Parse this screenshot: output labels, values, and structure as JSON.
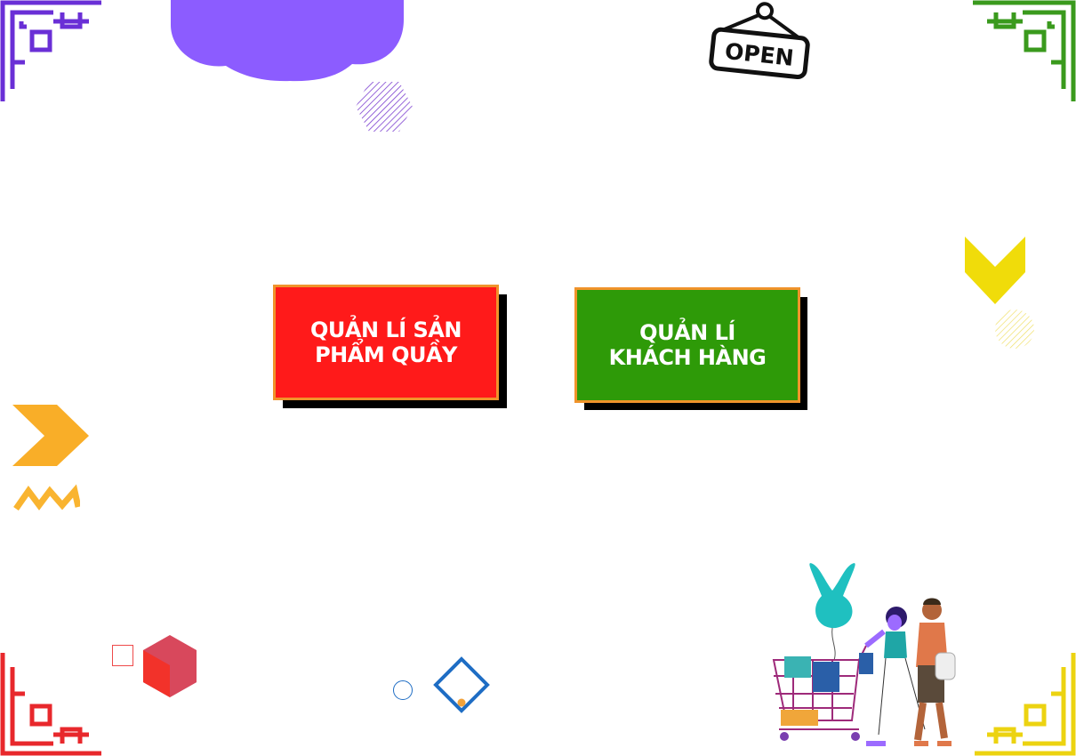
{
  "menu": {
    "products_button": {
      "line1": "QUẢN LÍ SẢN",
      "line2": "PHẨM QUẦY"
    },
    "customers_button": {
      "line1": "QUẢN LÍ",
      "line2": "KHÁCH HÀNG"
    }
  },
  "sign": {
    "text": "OPEN"
  },
  "colors": {
    "products_button": "#ff1a1a",
    "customers_button": "#2e9a08",
    "button_border": "#f0932b",
    "button_shadow": "#000000",
    "cloud": "#8c5cff",
    "corner_top_left": "#6a2fd6",
    "corner_top_right": "#3a9a1d",
    "corner_bottom_left": "#e8282c",
    "corner_bottom_right": "#ecd311"
  },
  "icons": [
    "corner-ornament-icon",
    "cloud-icon",
    "hexagon-icon",
    "open-sign-icon",
    "chevron-down-icon",
    "circle-icon",
    "chevron-right-icon",
    "zigzag-icon",
    "square-outline-icon",
    "cube-icon",
    "diamond-icon",
    "shopping-couple-illustration"
  ]
}
